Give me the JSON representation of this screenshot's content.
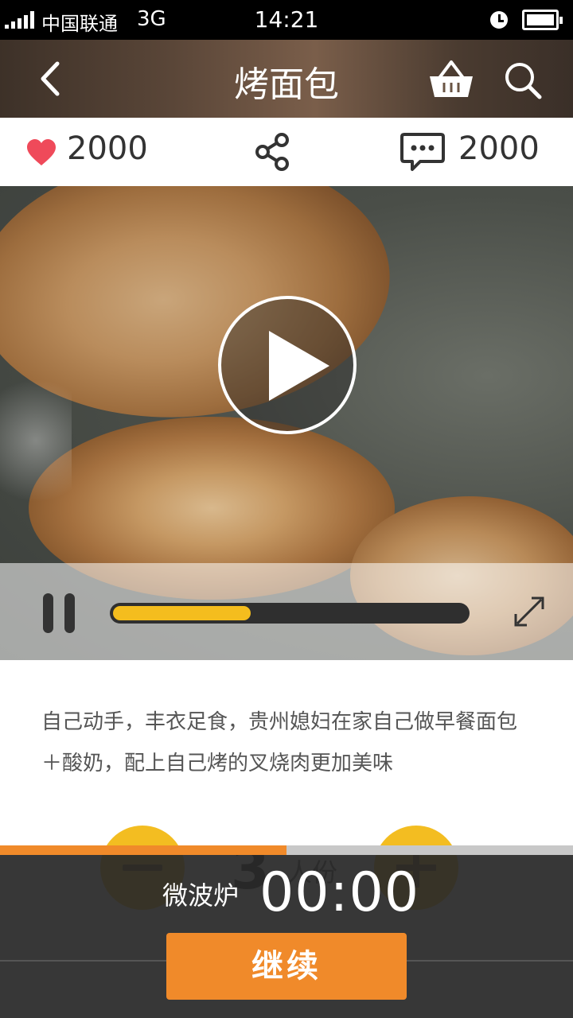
{
  "status_bar": {
    "carrier": "中国联通",
    "network": "3G",
    "time": "14:21",
    "icons": [
      "signal-icon",
      "alarm-icon",
      "battery-icon"
    ]
  },
  "header": {
    "title": "烤面包",
    "icons": [
      "back-arrow-icon",
      "basket-icon",
      "search-icon"
    ]
  },
  "stats": {
    "likes": "2000",
    "comments": "2000",
    "like_color": "#ef4a5a",
    "icons": [
      "heart-icon",
      "share-icon",
      "comment-icon"
    ]
  },
  "video": {
    "progress": 0.39,
    "progress_color": "#f4bd1e",
    "icons": [
      "play-icon",
      "pause-icon",
      "fullscreen-icon"
    ]
  },
  "description": "自己动手，丰衣足食，贵州媳妇在家自己做早餐面包＋酸奶，配上自己烤的叉烧肉更加美味",
  "servings": {
    "count": "3",
    "unit": "人份",
    "button_color": "#f3bd21"
  },
  "timer": {
    "label": "微波炉",
    "value": "00:00",
    "progress": 0.5,
    "accent_color": "#f08a2a"
  },
  "continue_button": "继续"
}
